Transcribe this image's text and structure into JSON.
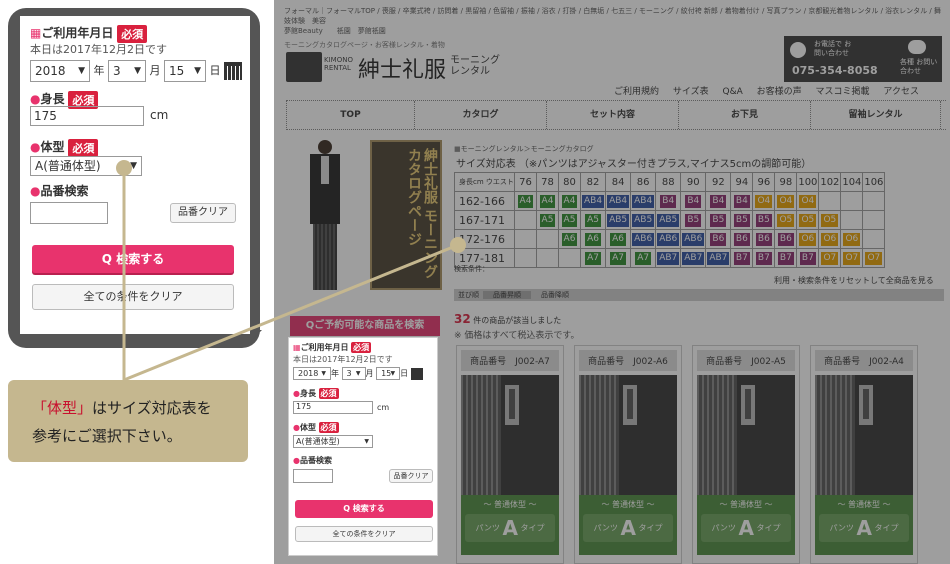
{
  "panel": {
    "date_label": "ご利用年月日",
    "required": "必須",
    "date_note": "本日は2017年12月2日です",
    "year": "2018",
    "year_unit": "年",
    "month": "3",
    "month_unit": "月",
    "day": "15",
    "day_unit": "日",
    "height_label": "身長",
    "height_value": "175",
    "height_unit": "cm",
    "body_label": "体型",
    "body_value": "A(普通体型)",
    "product_label": "品番検索",
    "product_clear": "品番クリア",
    "search_button": "検索する",
    "clear_all": "全ての条件をクリア"
  },
  "callout": {
    "highlight": "「体型」",
    "text1": "はサイズ対応表を",
    "text2": "参考にご選択下さい。"
  },
  "site": {
    "topnav": "フォーマル｜フォーマルTOP / 喪服 / 卒業式袴 / 訪問着 / 黒留袖 / 色留袖 / 振袖 / 浴衣 / 打掛 / 白無垢 / 七五三 / モーニング / 紋付袴 新郎 / 着物着付け / 写真プラン / 京都観光着物レンタル / 浴衣レンタル / 舞妓体験　美容",
    "topnav2": "夢館Beauty　　祇園　夢館祇園",
    "crumb_top": "モーニングカタログページ・お客様レンタル・着物",
    "brand_small": "KIMONO RENTAL",
    "brand": "紳士礼服",
    "brand_sub": "モーニング\nレンタル",
    "phone_label": "お電話で お問い合わせ",
    "phone": "075-354-8058",
    "contact": "各種 お問い合わせ",
    "links": [
      "ご利用規約",
      "サイズ表",
      "Q&A",
      "お客様の声",
      "マスコミ掲載",
      "アクセス"
    ],
    "nav": [
      "TOP",
      "カタログ",
      "セット内容",
      "お下見",
      "留袖レンタル"
    ],
    "breadcrumb": "モーニングレンタル＞モーニングカタログ",
    "catalog_title": "紳士礼服 モーニング カタログページ",
    "size_title": "サイズ対応表 （※パンツはアジャスター付きプラス,マイナス5cmの調節可能）",
    "waist_label": "ウエスト",
    "height_label": "身長cm",
    "waists": [
      "76",
      "78",
      "80",
      "82",
      "84",
      "86",
      "88",
      "90",
      "92",
      "94",
      "96",
      "98",
      "100",
      "102",
      "104",
      "106"
    ],
    "rows": [
      {
        "h": "162-166",
        "cells": [
          "A4",
          "A4",
          "A4",
          "AB4",
          "AB4",
          "AB4",
          "B4",
          "B4",
          "B4",
          "B4",
          "O4",
          "O4",
          "O4",
          "",
          "",
          ""
        ]
      },
      {
        "h": "167-171",
        "cells": [
          "",
          "A5",
          "A5",
          "A5",
          "AB5",
          "AB5",
          "AB5",
          "B5",
          "B5",
          "B5",
          "B5",
          "O5",
          "O5",
          "O5",
          "",
          ""
        ]
      },
      {
        "h": "172-176",
        "cells": [
          "",
          "",
          "A6",
          "A6",
          "A6",
          "AB6",
          "AB6",
          "AB6",
          "B6",
          "B6",
          "B6",
          "B6",
          "O6",
          "O6",
          "O6",
          ""
        ]
      },
      {
        "h": "177-181",
        "cells": [
          "",
          "",
          "",
          "A7",
          "A7",
          "A7",
          "AB7",
          "AB7",
          "AB7",
          "B7",
          "B7",
          "B7",
          "B7",
          "O7",
          "O7",
          "O7"
        ]
      }
    ],
    "search_cond": "検索条件：",
    "reset": "利用・検索条件をリセットして全商品を見る",
    "sort_tabs": [
      "並び順",
      "品番昇順",
      "品番降順"
    ],
    "result_count": "32",
    "result_text": "件の商品が該当しました",
    "tax_note": "※ 価格はすべて税込表示です。",
    "reserve_btn": "ご予約可能な商品を検索",
    "cards": [
      {
        "code": "商品番号　J002-A7",
        "type": "～ 普通体型 ～",
        "pants": "パンツ",
        "size": "A",
        "tail": "タイプ"
      },
      {
        "code": "商品番号　J002-A6",
        "type": "～ 普通体型 ～",
        "pants": "パンツ",
        "size": "A",
        "tail": "タイプ"
      },
      {
        "code": "商品番号　J002-A5",
        "type": "～ 普通体型 ～",
        "pants": "パンツ",
        "size": "A",
        "tail": "タイプ"
      },
      {
        "code": "商品番号　J002-A4",
        "type": "～ 普通体型 ～",
        "pants": "パンツ",
        "size": "A",
        "tail": "タイプ"
      }
    ]
  },
  "mini": {
    "date_label": "ご利用年月日",
    "required": "必須",
    "date_note": "本日は2017年12月2日です",
    "year": "2018",
    "year_unit": "年",
    "month": "3",
    "month_unit": "月",
    "day": "15",
    "day_unit": "日",
    "height_label": "身長",
    "height_value": "175",
    "height_unit": "cm",
    "body_label": "体型",
    "body_value": "A(普通体型)",
    "product_label": "品番検索",
    "product_clear": "品番クリア",
    "search_button": "検索する",
    "clear_all": "全ての条件をクリア"
  },
  "colors": {
    "required": "#d9213e",
    "pink": "#e8336d",
    "callout_bg": "#c5b78f",
    "callout_red": "#c8102e",
    "panel_border": "#555555"
  }
}
